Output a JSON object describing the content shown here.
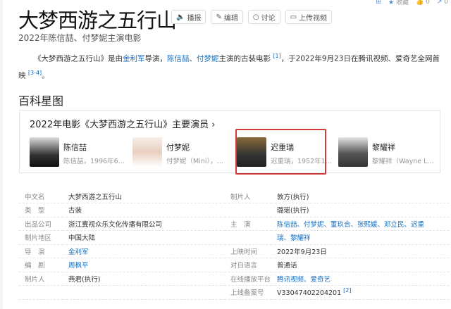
{
  "topbar": {
    "collect": "收藏",
    "likes": "0",
    "shares": "0"
  },
  "title": "大梦西游之五行山",
  "buttons": [
    "播报",
    "编辑",
    "讨论",
    "上传视频"
  ],
  "subtitle": "2022年陈信喆、付梦妮主演电影",
  "intro": {
    "p1": "《大梦西游之五行山》是由",
    "director": "金利军",
    "p2": "导演，",
    "actor1": "陈信喆",
    "sep": "、",
    "actor2": "付梦妮",
    "p3": "主演的古装电影",
    "ref1": "[1]",
    "p4": "，于2022年9月23日在腾讯视频、爱奇艺全网首映",
    "ref2": "[3-4]",
    "end": "。"
  },
  "section_title": "百科星图",
  "cast_card": {
    "title": "2022年电影《大梦西游之五行山》主要演员",
    "chevron": "›",
    "actors": [
      {
        "name": "陈信喆",
        "desc": "陈信喆，1996年6..."
      },
      {
        "name": "付梦妮",
        "desc": "付梦妮（Mini），..."
      },
      {
        "name": "迟重瑞",
        "desc": "迟重瑞，1952年1..."
      },
      {
        "name": "黎耀祥",
        "desc": "黎耀祥（Wayne L..."
      }
    ]
  },
  "infobox": [
    [
      "中文名",
      "大梦西游之五行山",
      "制片人",
      "敦方(执行)"
    ],
    [
      "类　型",
      "古装",
      "",
      "璐瑶(执行)"
    ],
    [
      "出品公司",
      "浙江冀视众乐文化传播有限公司",
      "主　演",
      "陈信喆、付梦妮、董玖合、张熙媛、邓立民、迟重"
    ],
    [
      "制片地区",
      "中国大陆",
      "",
      "瑞、黎耀祥"
    ],
    [
      "导　演",
      "金利军",
      "上映时间",
      "2022年9月23日"
    ],
    [
      "编　剧",
      "周枫平",
      "对白语言",
      "普通话"
    ],
    [
      "制片人",
      "燕君(执行)",
      "在线播放平台",
      "腾讯视频、爱奇艺"
    ],
    [
      "",
      "",
      "上线备案号",
      "V33047402204201"
    ]
  ],
  "infobox_ref": "[2]"
}
